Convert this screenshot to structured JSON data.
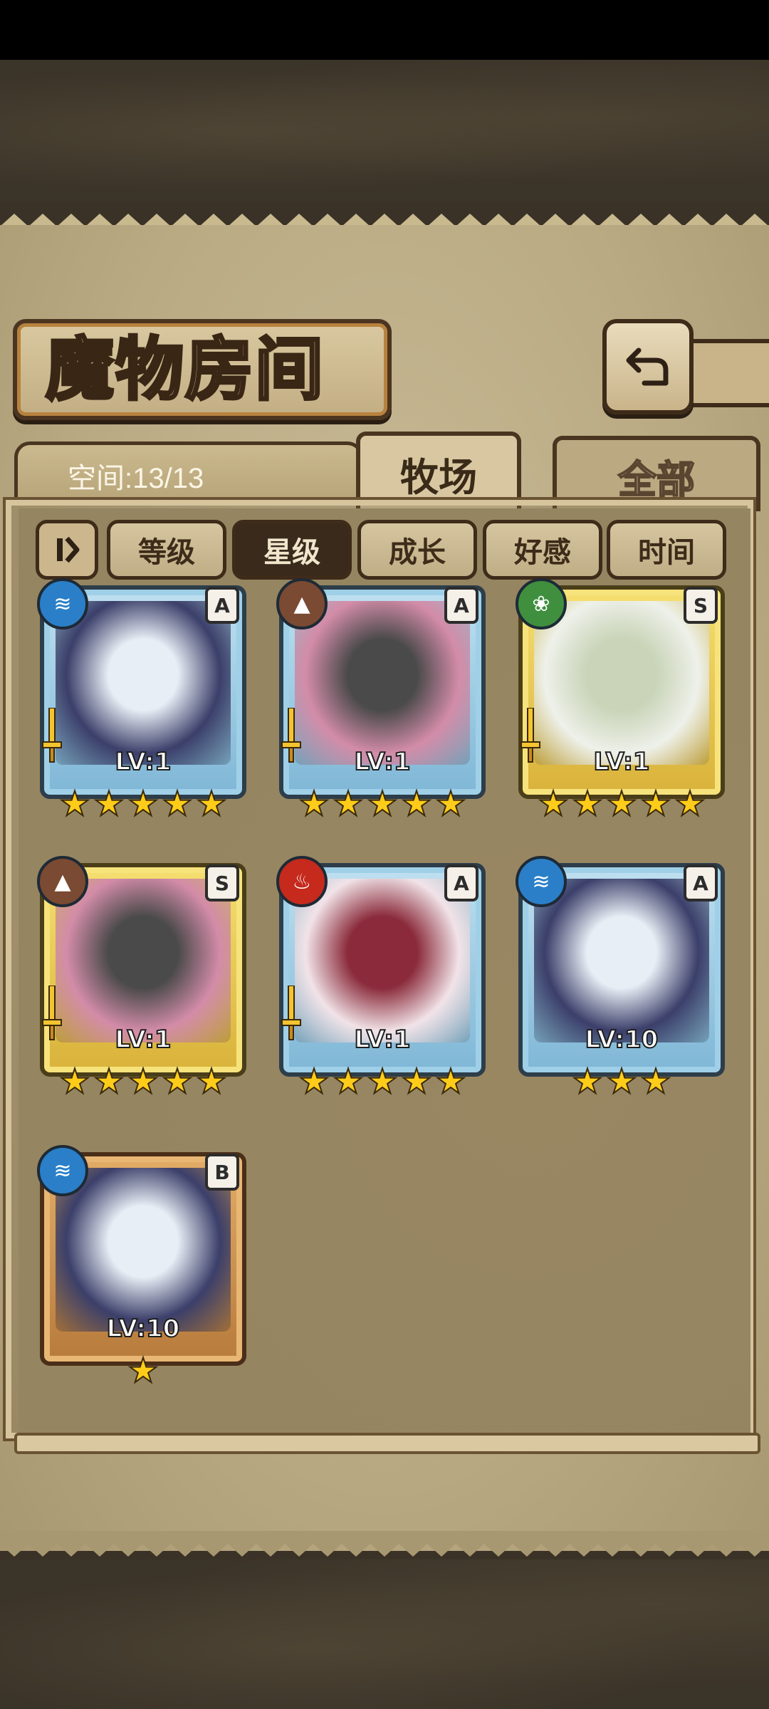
{
  "header": {
    "title": "魔物房间",
    "back_icon": "return-arrow-icon"
  },
  "tabs": {
    "space_text": "空间:13/13",
    "ranch_label": "牧场",
    "all_label": "全部"
  },
  "filters": {
    "toggle_icon": "pause-sort-icon",
    "items": [
      {
        "label": "等级",
        "active": false
      },
      {
        "label": "星级",
        "active": true
      },
      {
        "label": "成长",
        "active": false
      },
      {
        "label": "好感",
        "active": false
      },
      {
        "label": "时间",
        "active": false
      }
    ]
  },
  "cards": [
    {
      "level": "LV:1",
      "rank": "A",
      "element": "water",
      "stars": 5,
      "frame": "blue"
    },
    {
      "level": "LV:1",
      "rank": "A",
      "element": "earth",
      "stars": 5,
      "frame": "blue"
    },
    {
      "level": "LV:1",
      "rank": "S",
      "element": "wood",
      "stars": 5,
      "frame": "gold"
    },
    {
      "level": "LV:1",
      "rank": "S",
      "element": "earth",
      "stars": 5,
      "frame": "gold"
    },
    {
      "level": "LV:1",
      "rank": "A",
      "element": "fire",
      "stars": 5,
      "frame": "blue"
    },
    {
      "level": "LV:10",
      "rank": "A",
      "element": "water",
      "stars": 3,
      "frame": "blue"
    },
    {
      "level": "LV:10",
      "rank": "B",
      "element": "water",
      "stars": 1,
      "frame": "bronze"
    }
  ],
  "colors": {
    "parchment": "#b9aa83",
    "dark_brown": "#3e2b19",
    "star_gold": "#ffcc1a"
  }
}
